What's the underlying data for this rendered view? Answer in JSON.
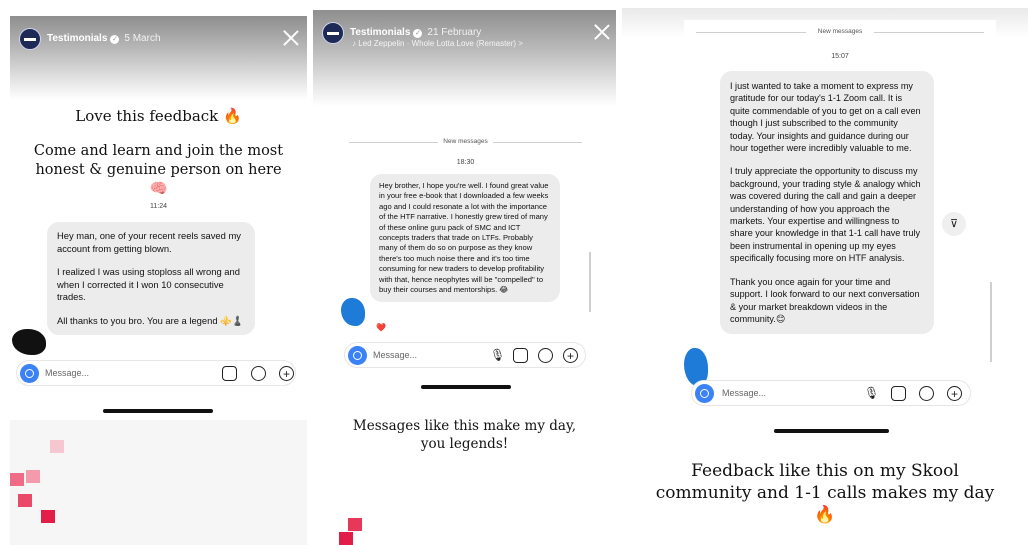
{
  "colors": {
    "accent": "#3b82f6",
    "bubble": "#ececec",
    "heart": "#e8385a",
    "scribble": "#1f7bd8"
  },
  "panel1": {
    "account": "Testimonials",
    "date": "5 March",
    "caption_line1": "Love this feedback 🔥",
    "caption_line2": "Come and learn and join the most honest & genuine person on here 🧠",
    "time": "11:24",
    "message": [
      "Hey man, one of your recent reels saved my account from getting blown.",
      "I realized I was using stoploss all wrong and when I corrected it I won 10 consecutive trades.",
      "All thanks to you bro. You are a legend ⚜️♟️"
    ],
    "input_placeholder": "Message..."
  },
  "panel2": {
    "account": "Testimonials",
    "date": "21 February",
    "music": "♪ Led Zeppelin · Whole Lotta Love (Remaster) >",
    "new_messages": "New messages",
    "time": "18:30",
    "message": "Hey brother, I hope you're well. I found great value in your free e-book that I downloaded a few weeks ago and I could resonate a lot with the importance of the HTF narrative. I honestly grew tired of many of these online guru pack of SMC and ICT concepts traders that trade on LTFs. Probably many of them do so on purpose as they know there's too much noise there and it's too time consuming for new traders to develop profitability with that, hence neophytes will be \"compelled\" to buy their courses and mentorships. 😂",
    "reaction": "❤️",
    "input_placeholder": "Message...",
    "caption": "Messages like this make my day, you legends!"
  },
  "panel3": {
    "new_messages": "New messages",
    "time": "15:07",
    "message": [
      "I just wanted to take a moment to express my gratitude for our today's 1-1 Zoom call. It is quite commendable of you to get on a call even though I just subscribed to the community today. Your insights and guidance during our hour together were incredibly valuable to me.",
      "I truly appreciate the opportunity to discuss my background, your trading style & analogy which was covered during the call and gain a deeper understanding of how you approach the markets. Your expertise and willingness to share your knowledge in that 1-1 call have truly been instrumental in opening up my eyes specifically focusing more on HTF analysis.",
      "Thank you once again for your time and support. I look forward to our next conversation & your market breakdown videos in the community.😊"
    ],
    "input_placeholder": "Message...",
    "caption": "Feedback like this on my Skool community and 1-1 calls makes my day 🔥"
  },
  "icons": {
    "send": "send-icon",
    "mic": "mic-icon",
    "gallery": "gallery-icon",
    "sticker": "sticker-icon",
    "add": "add-icon"
  }
}
